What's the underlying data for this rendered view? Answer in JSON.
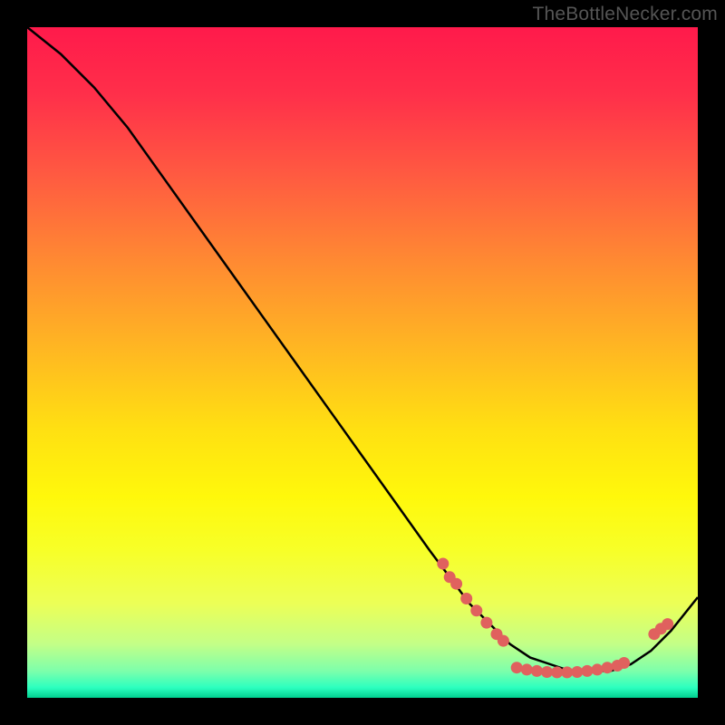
{
  "watermark": "TheBottleNecker.com",
  "chart_data": {
    "type": "line",
    "title": "",
    "xlabel": "",
    "ylabel": "",
    "xlim": [
      0,
      100
    ],
    "ylim": [
      0,
      100
    ],
    "series": [
      {
        "name": "curve",
        "x": [
          0,
          5,
          10,
          15,
          20,
          25,
          30,
          35,
          40,
          45,
          50,
          55,
          60,
          63,
          66,
          69,
          72,
          75,
          78,
          81,
          84,
          87,
          90,
          93,
          96,
          100
        ],
        "values": [
          100,
          96,
          91,
          85,
          78,
          71,
          64,
          57,
          50,
          43,
          36,
          29,
          22,
          18,
          14,
          11,
          8,
          6,
          5,
          4,
          4,
          4,
          5,
          7,
          10,
          15
        ]
      }
    ],
    "markers": [
      {
        "x": 62,
        "y": 20
      },
      {
        "x": 63,
        "y": 18
      },
      {
        "x": 64,
        "y": 17
      },
      {
        "x": 65.5,
        "y": 14.8
      },
      {
        "x": 67,
        "y": 13
      },
      {
        "x": 68.5,
        "y": 11.2
      },
      {
        "x": 70,
        "y": 9.5
      },
      {
        "x": 71,
        "y": 8.5
      },
      {
        "x": 73,
        "y": 4.5
      },
      {
        "x": 74.5,
        "y": 4.2
      },
      {
        "x": 76,
        "y": 4.0
      },
      {
        "x": 77.5,
        "y": 3.85
      },
      {
        "x": 79,
        "y": 3.8
      },
      {
        "x": 80.5,
        "y": 3.8
      },
      {
        "x": 82,
        "y": 3.85
      },
      {
        "x": 83.5,
        "y": 4.0
      },
      {
        "x": 85,
        "y": 4.2
      },
      {
        "x": 86.5,
        "y": 4.5
      },
      {
        "x": 88,
        "y": 4.8
      },
      {
        "x": 89,
        "y": 5.2
      },
      {
        "x": 93.5,
        "y": 9.5
      },
      {
        "x": 94.5,
        "y": 10.3
      },
      {
        "x": 95.5,
        "y": 11
      }
    ],
    "gradient_stops": [
      {
        "offset": 0.0,
        "color": "#ff1a4b"
      },
      {
        "offset": 0.1,
        "color": "#ff2f4a"
      },
      {
        "offset": 0.22,
        "color": "#ff5a41"
      },
      {
        "offset": 0.35,
        "color": "#ff8a32"
      },
      {
        "offset": 0.48,
        "color": "#ffb722"
      },
      {
        "offset": 0.6,
        "color": "#ffe012"
      },
      {
        "offset": 0.7,
        "color": "#fff80b"
      },
      {
        "offset": 0.78,
        "color": "#f7ff28"
      },
      {
        "offset": 0.86,
        "color": "#ecff57"
      },
      {
        "offset": 0.92,
        "color": "#c3ff87"
      },
      {
        "offset": 0.96,
        "color": "#7dffab"
      },
      {
        "offset": 0.985,
        "color": "#2bffbf"
      },
      {
        "offset": 1.0,
        "color": "#00cf8f"
      }
    ],
    "marker_color": "#e0615e",
    "curve_color": "#000000"
  }
}
